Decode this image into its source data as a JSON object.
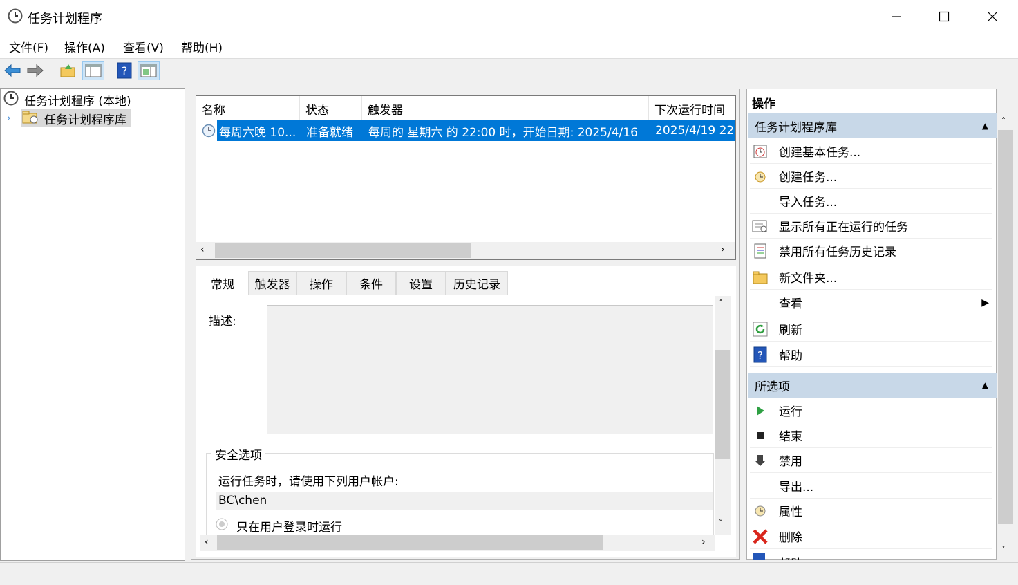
{
  "window": {
    "title": "任务计划程序"
  },
  "menu": [
    "文件(F)",
    "操作(A)",
    "查看(V)",
    "帮助(H)"
  ],
  "tree": {
    "root": "任务计划程序 (本地)",
    "child": "任务计划程序库"
  },
  "task_list": {
    "columns": [
      "名称",
      "状态",
      "触发器",
      "下次运行时间"
    ],
    "rows": [
      {
        "name": "每周六晚 10...",
        "status": "准备就绪",
        "trigger": "每周的 星期六 的 22:00 时，开始日期: 2025/4/16",
        "next_run": "2025/4/19 22"
      }
    ]
  },
  "tabs": [
    "常规",
    "触发器",
    "操作",
    "条件",
    "设置",
    "历史记录"
  ],
  "general": {
    "description_label": "描述:",
    "security_group": "安全选项",
    "run_as_label": "运行任务时，请使用下列用户帐户:",
    "user": "BC\\chen",
    "radio_label": "只在用户登录时运行"
  },
  "actions_panel": {
    "title": "操作",
    "section1": {
      "header": "任务计划程序库",
      "items": [
        "创建基本任务...",
        "创建任务...",
        "导入任务...",
        "显示所有正在运行的任务",
        "禁用所有任务历史记录",
        "新文件夹...",
        "查看",
        "刷新",
        "帮助"
      ]
    },
    "section2": {
      "header": "所选项",
      "items": [
        "运行",
        "结束",
        "禁用",
        "导出...",
        "属性",
        "删除",
        "帮助"
      ]
    }
  },
  "colors": {
    "selection": "#0078d7",
    "section_header": "#c8d8e8"
  }
}
